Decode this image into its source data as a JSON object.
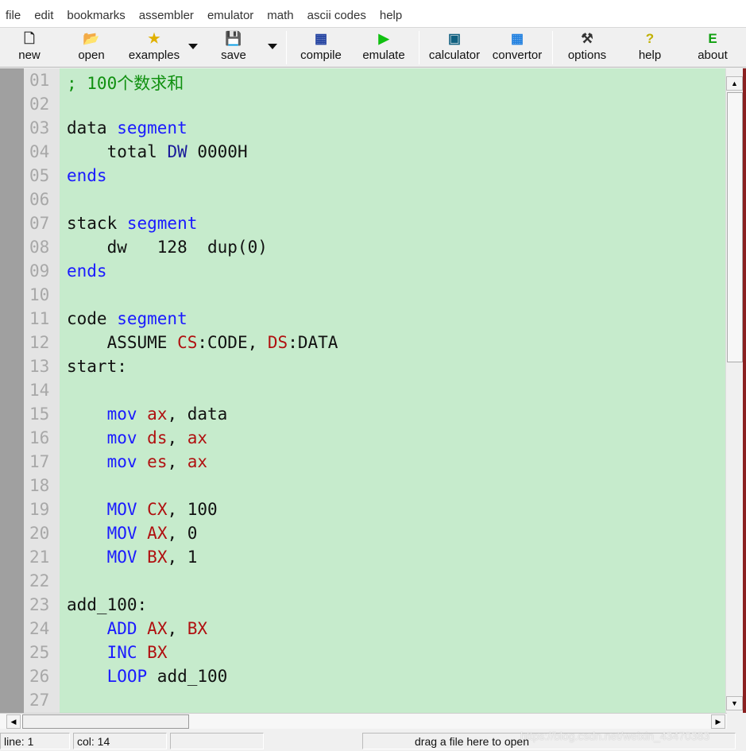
{
  "menu": [
    "file",
    "edit",
    "bookmarks",
    "assembler",
    "emulator",
    "math",
    "ascii codes",
    "help"
  ],
  "toolbar": [
    {
      "label": "new",
      "icon": "new-file-icon",
      "glyph": "🗋",
      "color": "#222"
    },
    {
      "label": "open",
      "icon": "open-folder-icon",
      "glyph": "📂",
      "color": "#b08a00"
    },
    {
      "label": "examples",
      "icon": "star-icon",
      "glyph": "★",
      "color": "#e0b000"
    },
    {
      "label": "save",
      "icon": "floppy-disk-icon",
      "glyph": "💾",
      "color": "#333"
    },
    {
      "label": "compile",
      "icon": "compile-icon",
      "glyph": "▦",
      "color": "#2040a0"
    },
    {
      "label": "emulate",
      "icon": "play-icon",
      "glyph": "▶",
      "color": "#10c010"
    },
    {
      "label": "calculator",
      "icon": "calculator-icon",
      "glyph": "▣",
      "color": "#106080"
    },
    {
      "label": "convertor",
      "icon": "convertor-icon",
      "glyph": "▦",
      "color": "#2080e0"
    },
    {
      "label": "options",
      "icon": "tools-icon",
      "glyph": "⚒",
      "color": "#333"
    },
    {
      "label": "help",
      "icon": "question-icon",
      "glyph": "?",
      "color": "#c0b000"
    },
    {
      "label": "about",
      "icon": "chip-icon",
      "glyph": "E",
      "color": "#10a010"
    }
  ],
  "code": [
    [
      [
        "; 100个数求和",
        "c"
      ]
    ],
    [],
    [
      [
        "data ",
        ""
      ],
      [
        "segment",
        "k"
      ]
    ],
    [
      [
        "    total ",
        ""
      ],
      [
        "DW",
        "t"
      ],
      [
        " 0000H",
        ""
      ]
    ],
    [
      [
        "ends",
        "k"
      ]
    ],
    [],
    [
      [
        "stack ",
        ""
      ],
      [
        "segment",
        "k"
      ]
    ],
    [
      [
        "    dw   128  dup(0)",
        ""
      ]
    ],
    [
      [
        "ends",
        "k"
      ]
    ],
    [],
    [
      [
        "code ",
        ""
      ],
      [
        "segment",
        "k"
      ]
    ],
    [
      [
        "    ASSUME ",
        ""
      ],
      [
        "CS",
        "r"
      ],
      [
        ":CODE, ",
        ""
      ],
      [
        "DS",
        "r"
      ],
      [
        ":DATA",
        ""
      ]
    ],
    [
      [
        "start:",
        ""
      ]
    ],
    [],
    [
      [
        "    ",
        ""
      ],
      [
        "mov",
        "k"
      ],
      [
        " ",
        ""
      ],
      [
        "ax",
        "r"
      ],
      [
        ", data",
        ""
      ]
    ],
    [
      [
        "    ",
        ""
      ],
      [
        "mov",
        "k"
      ],
      [
        " ",
        ""
      ],
      [
        "ds",
        "r"
      ],
      [
        ", ",
        ""
      ],
      [
        "ax",
        "r"
      ]
    ],
    [
      [
        "    ",
        ""
      ],
      [
        "mov",
        "k"
      ],
      [
        " ",
        ""
      ],
      [
        "es",
        "r"
      ],
      [
        ", ",
        ""
      ],
      [
        "ax",
        "r"
      ]
    ],
    [],
    [
      [
        "    ",
        ""
      ],
      [
        "MOV",
        "k"
      ],
      [
        " ",
        ""
      ],
      [
        "CX",
        "r"
      ],
      [
        ", 100",
        ""
      ]
    ],
    [
      [
        "    ",
        ""
      ],
      [
        "MOV",
        "k"
      ],
      [
        " ",
        ""
      ],
      [
        "AX",
        "r"
      ],
      [
        ", 0",
        ""
      ]
    ],
    [
      [
        "    ",
        ""
      ],
      [
        "MOV",
        "k"
      ],
      [
        " ",
        ""
      ],
      [
        "BX",
        "r"
      ],
      [
        ", 1",
        ""
      ]
    ],
    [],
    [
      [
        "add_100:",
        ""
      ]
    ],
    [
      [
        "    ",
        ""
      ],
      [
        "ADD",
        "k"
      ],
      [
        " ",
        ""
      ],
      [
        "AX",
        "r"
      ],
      [
        ", ",
        ""
      ],
      [
        "BX",
        "r"
      ]
    ],
    [
      [
        "    ",
        ""
      ],
      [
        "INC",
        "k"
      ],
      [
        " ",
        ""
      ],
      [
        "BX",
        "r"
      ]
    ],
    [
      [
        "    ",
        ""
      ],
      [
        "LOOP",
        "k"
      ],
      [
        " add_100",
        ""
      ]
    ],
    []
  ],
  "status": {
    "line": "line: 1",
    "col": "col: 14",
    "hint": "drag a file here to open"
  },
  "watermark": "https://blog.csdn.net/weixin_43470383"
}
